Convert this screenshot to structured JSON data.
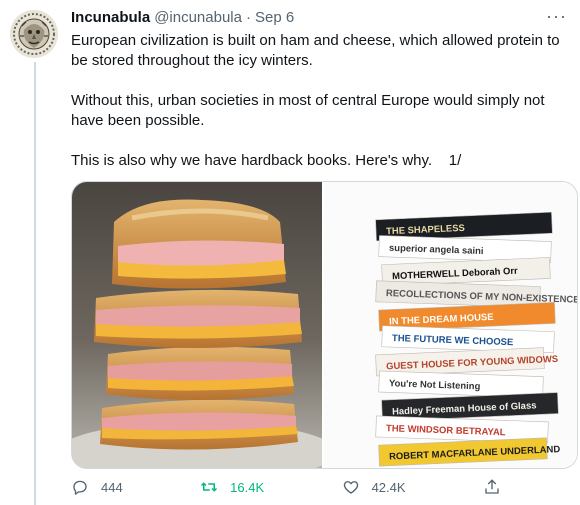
{
  "tweet": {
    "author_name": "Incunabula",
    "author_handle": "@incunabula",
    "separator": "·",
    "date": "Sep 6",
    "more_label": "···",
    "paragraphs": [
      "European civilization is built on ham and cheese, which allowed protein to be stored throughout the icy winters.",
      "Without this, urban societies in most of central Europe would simply not have been possible.",
      "This is also why we have hardback books. Here's why.    1/"
    ]
  },
  "media": [
    {
      "icon": "ham-cheese-sandwich-photo"
    },
    {
      "icon": "book-stack-photo"
    }
  ],
  "books": [
    {
      "title": "THE SHAPELESS",
      "color": "#1b1e22",
      "text": "#e9d9a6"
    },
    {
      "title": "superior   angela saini",
      "color": "#ffffff",
      "text": "#333333"
    },
    {
      "title": "MOTHERWELL   Deborah Orr",
      "color": "#f3f0ea",
      "text": "#111111"
    },
    {
      "title": "RECOLLECTIONS OF MY NON-EXISTENCE   REBECCA SOLNIT",
      "color": "#ede9e3",
      "text": "#555555"
    },
    {
      "title": "IN THE DREAM HOUSE",
      "color": "#f08a2c",
      "text": "#ffffff"
    },
    {
      "title": "THE FUTURE WE CHOOSE",
      "color": "#ffffff",
      "text": "#1a4f8f"
    },
    {
      "title": "GUEST HOUSE FOR YOUNG WIDOWS",
      "color": "#f6f1ea",
      "text": "#b3432c"
    },
    {
      "title": "You're Not Listening",
      "color": "#ffffff",
      "text": "#333333"
    },
    {
      "title": "Hadley Freeman House of Glass",
      "color": "#25272b",
      "text": "#f2efe6"
    },
    {
      "title": "THE WINDSOR BETRAYAL",
      "color": "#ffffff",
      "text": "#c23a2b"
    },
    {
      "title": "ROBERT MACFARLANE   UNDERLAND",
      "color": "#f1c830",
      "text": "#1c1c1c"
    }
  ],
  "actions": {
    "reply_count": "444",
    "retweet_count": "16.4K",
    "like_count": "42.4K"
  },
  "colors": {
    "text": "#0f1419",
    "secondary": "#536471",
    "retweet": "#00ba7c",
    "border": "#cfd9de"
  }
}
